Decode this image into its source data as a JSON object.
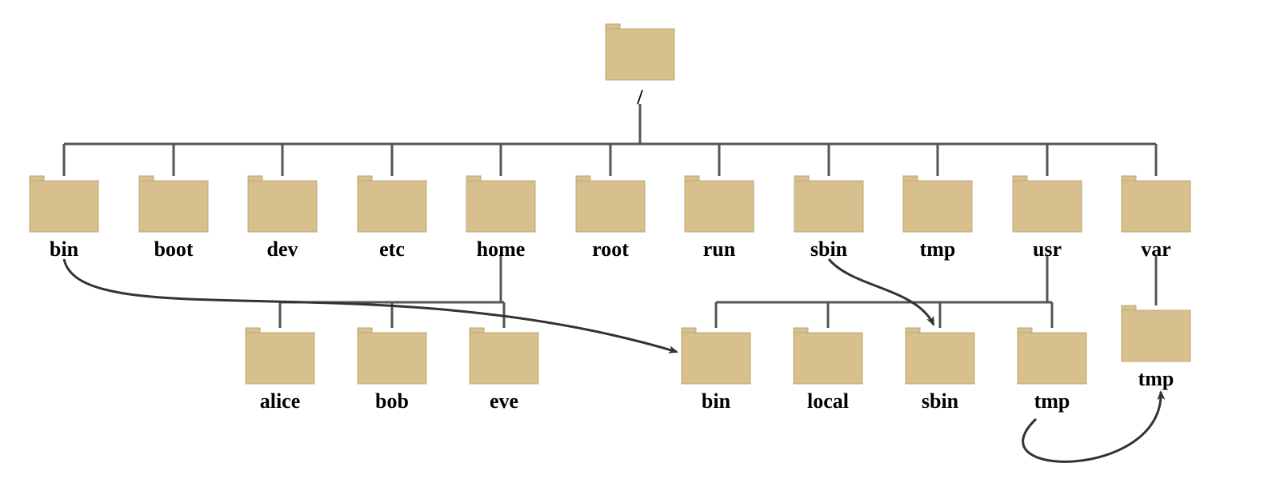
{
  "diagram": {
    "root_label": "/",
    "level1": [
      "bin",
      "boot",
      "dev",
      "etc",
      "home",
      "root",
      "run",
      "sbin",
      "tmp",
      "usr",
      "var"
    ],
    "home_children": [
      "alice",
      "bob",
      "eve"
    ],
    "usr_children": [
      "bin",
      "local",
      "sbin",
      "tmp"
    ],
    "var_child": "tmp",
    "symlinks": [
      {
        "from": "/bin",
        "to": "/usr/bin"
      },
      {
        "from": "/sbin",
        "to": "/usr/sbin"
      },
      {
        "from": "/tmp",
        "to": "/var/tmp"
      }
    ],
    "colors": {
      "folder_fill": "#d7bf8e",
      "folder_stroke": "#bba876",
      "line": "#555555",
      "arrow": "#333333"
    }
  }
}
